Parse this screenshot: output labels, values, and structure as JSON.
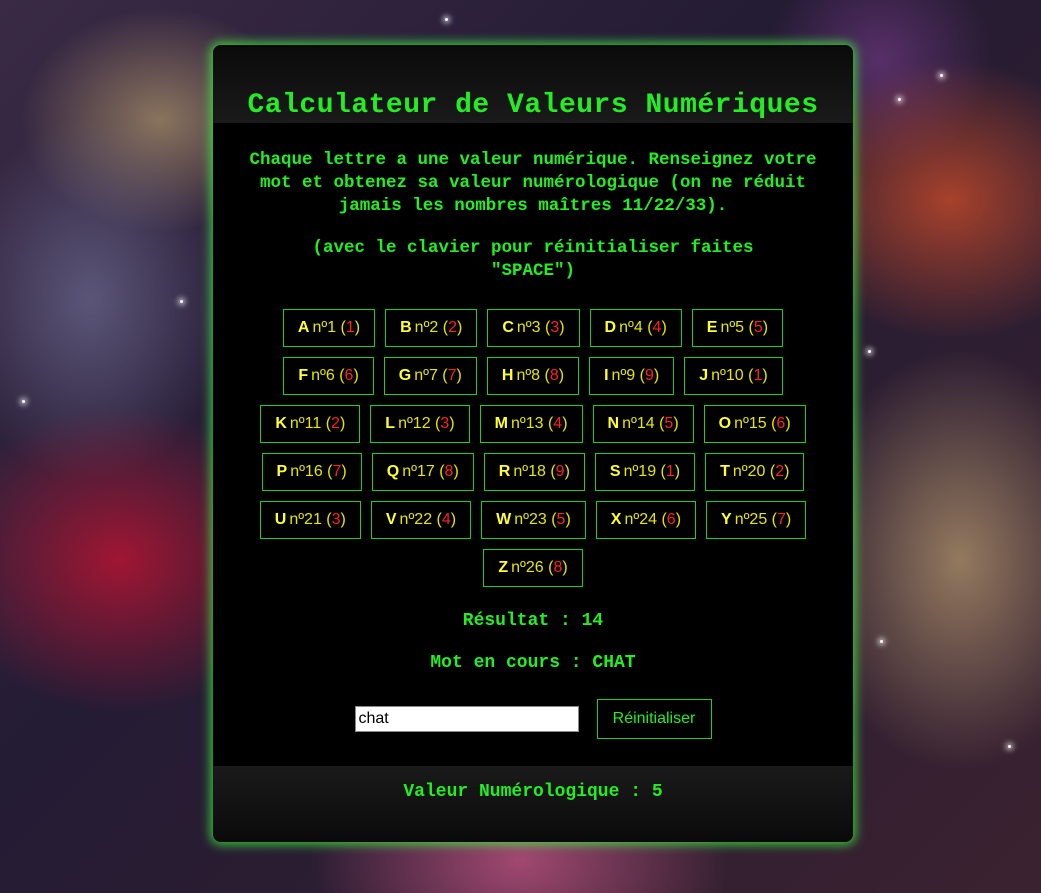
{
  "title": "Calculateur de Valeurs Numériques",
  "intro": "Chaque lettre a une valeur numérique. Renseignez votre mot et obtenez sa valeur numérologique (on ne réduit jamais les nombres maîtres 11/22/33).",
  "hint": "(avec le clavier pour réinitialiser faites \"SPACE\")",
  "letters": [
    {
      "letter": "A",
      "num": "nº1",
      "val": "1"
    },
    {
      "letter": "B",
      "num": "nº2",
      "val": "2"
    },
    {
      "letter": "C",
      "num": "nº3",
      "val": "3"
    },
    {
      "letter": "D",
      "num": "nº4",
      "val": "4"
    },
    {
      "letter": "E",
      "num": "nº5",
      "val": "5"
    },
    {
      "letter": "F",
      "num": "nº6",
      "val": "6"
    },
    {
      "letter": "G",
      "num": "nº7",
      "val": "7"
    },
    {
      "letter": "H",
      "num": "nº8",
      "val": "8"
    },
    {
      "letter": "I",
      "num": "nº9",
      "val": "9"
    },
    {
      "letter": "J",
      "num": "nº10",
      "val": "1"
    },
    {
      "letter": "K",
      "num": "nº11",
      "val": "2"
    },
    {
      "letter": "L",
      "num": "nº12",
      "val": "3"
    },
    {
      "letter": "M",
      "num": "nº13",
      "val": "4"
    },
    {
      "letter": "N",
      "num": "nº14",
      "val": "5"
    },
    {
      "letter": "O",
      "num": "nº15",
      "val": "6"
    },
    {
      "letter": "P",
      "num": "nº16",
      "val": "7"
    },
    {
      "letter": "Q",
      "num": "nº17",
      "val": "8"
    },
    {
      "letter": "R",
      "num": "nº18",
      "val": "9"
    },
    {
      "letter": "S",
      "num": "nº19",
      "val": "1"
    },
    {
      "letter": "T",
      "num": "nº20",
      "val": "2"
    },
    {
      "letter": "U",
      "num": "nº21",
      "val": "3"
    },
    {
      "letter": "V",
      "num": "nº22",
      "val": "4"
    },
    {
      "letter": "W",
      "num": "nº23",
      "val": "5"
    },
    {
      "letter": "X",
      "num": "nº24",
      "val": "6"
    },
    {
      "letter": "Y",
      "num": "nº25",
      "val": "7"
    },
    {
      "letter": "Z",
      "num": "nº26",
      "val": "8"
    }
  ],
  "result": "Résultat : 14",
  "current_word": "Mot en cours : CHAT",
  "input": {
    "value": "chat"
  },
  "reset_label": "Réinitialiser",
  "numerology": "Valeur Numérologique : 5",
  "colors": {
    "accent": "#22ee22",
    "letter": "#ffff33",
    "value": "#ff2020",
    "panel": "#000000"
  }
}
